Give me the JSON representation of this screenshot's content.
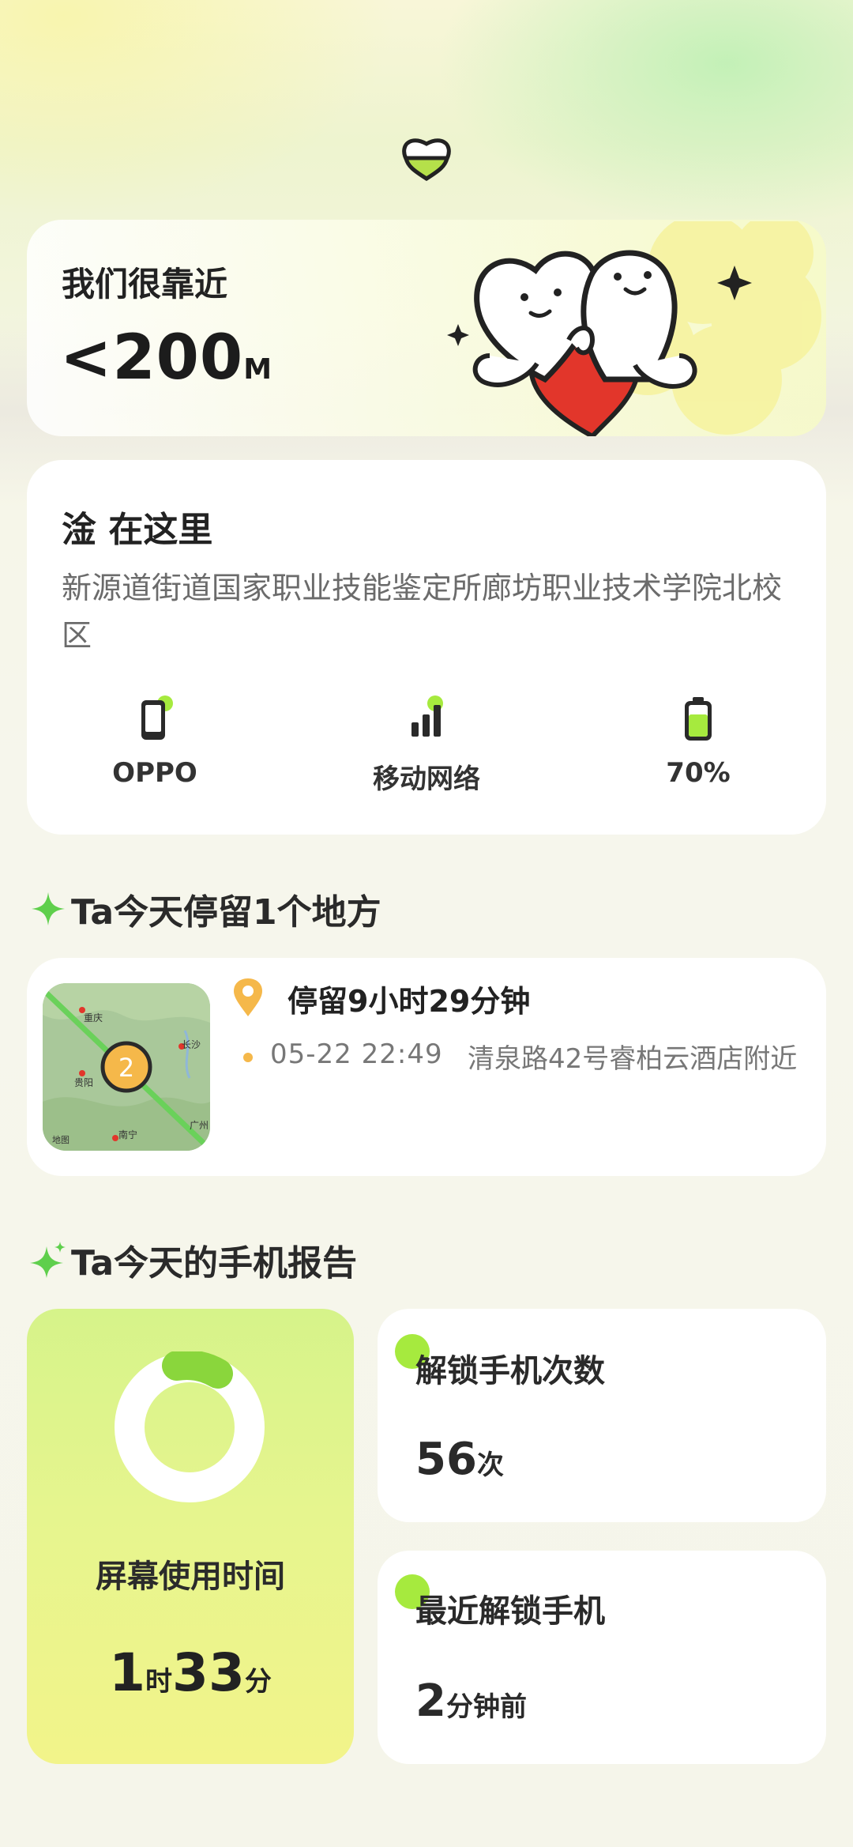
{
  "colors": {
    "accent_green": "#a6ea3e",
    "accent_orange": "#f5b84a",
    "heart_red": "#e2362b",
    "card_white": "#ffffff",
    "gradient_card_top": "#d6f38a",
    "gradient_card_bottom": "#f2f48a"
  },
  "header": {
    "logo_icon": "heart-half-filled-icon"
  },
  "distance": {
    "title": "我们很靠近",
    "value": "<200",
    "unit": "M",
    "illustration": "two-heart-characters-on-red-heart"
  },
  "location": {
    "title": "淦 在这里",
    "address": "新源道街道国家职业技能鉴定所廊坊职业技术学院北校区",
    "stats": [
      {
        "icon": "phone-icon",
        "label": "OPPO"
      },
      {
        "icon": "signal-bars-icon",
        "label": "移动网络"
      },
      {
        "icon": "battery-icon",
        "label": "70%",
        "level": 0.7
      }
    ]
  },
  "places": {
    "heading": "Ta今天停留1个地方",
    "map": {
      "labels": [
        "重庆",
        "长沙",
        "贵阳",
        "南宁",
        "广州",
        "地图"
      ],
      "marker_count": "2"
    },
    "stay": {
      "duration": "停留9小时29分钟",
      "time": "05-22 22:49",
      "place": "清泉路42号睿柏云酒店附近"
    }
  },
  "report": {
    "heading": "Ta今天的手机报告",
    "screen_time": {
      "label": "屏幕使用时间",
      "hours": "1",
      "hours_unit": "时",
      "minutes": "33",
      "minutes_unit": "分"
    },
    "unlock_count": {
      "label": "解锁手机次数",
      "value": "56",
      "unit": "次"
    },
    "last_unlock": {
      "label": "最近解锁手机",
      "value": "2",
      "unit": "分钟前"
    }
  }
}
